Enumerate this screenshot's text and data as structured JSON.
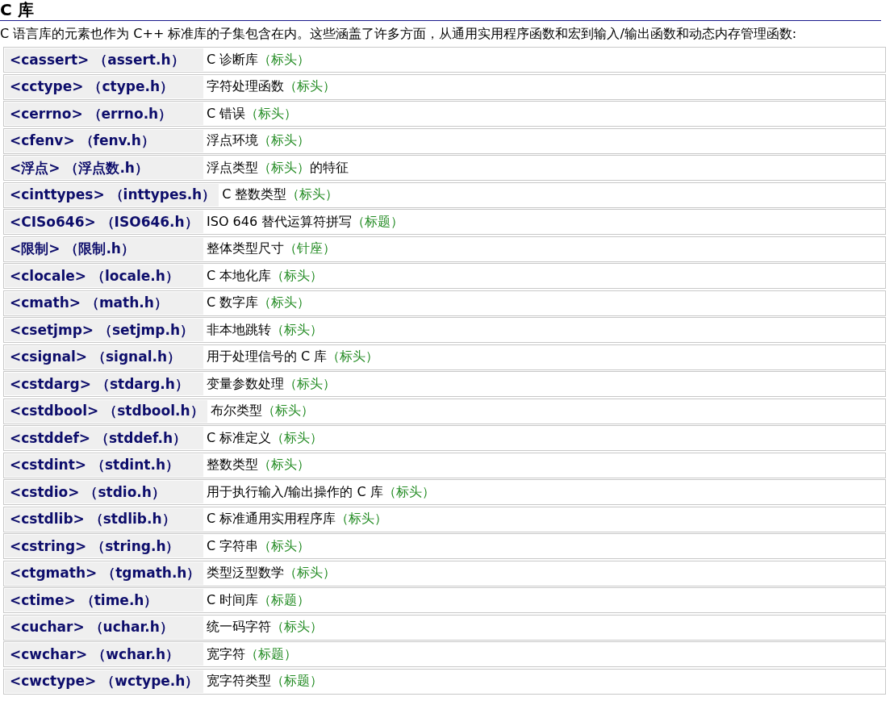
{
  "title": "C 库",
  "intro": "C 语言库的元素也作为 C++ 标准库的子集包含在内。这些涵盖了许多方面，从通用实用程序函数和宏到输入/输出函数和动态内存管理函数:",
  "libraries": [
    {
      "header": "<cassert> （assert.h）",
      "text": "C 诊断库",
      "note": "（标头）"
    },
    {
      "header": "<cctype> （ctype.h）",
      "text": "字符处理函数",
      "note": "（标头）"
    },
    {
      "header": "<cerrno> （errno.h）",
      "text": "C 错误",
      "note": "（标头）"
    },
    {
      "header": "<cfenv> （fenv.h）",
      "text": "浮点环境",
      "note": "（标头）"
    },
    {
      "header": "<浮点> （浮点数.h）",
      "text": "浮点类型",
      "note": "（标头）",
      "suffix": "的特征"
    },
    {
      "header": "<cinttypes> （inttypes.h）",
      "text": "C 整数类型",
      "note": "（标头）"
    },
    {
      "header": "<CISo646> （ISO646.h）",
      "text": "ISO 646 替代运算符拼写",
      "note": "（标题）"
    },
    {
      "header": "<限制> （限制.h）",
      "text": "整体类型尺寸",
      "note": "（针座）"
    },
    {
      "header": "<clocale> （locale.h）",
      "text": "C 本地化库",
      "note": "（标头）"
    },
    {
      "header": "<cmath> （math.h）",
      "text": "C 数字库",
      "note": "（标头）"
    },
    {
      "header": "<csetjmp> （setjmp.h）",
      "text": "非本地跳转",
      "note": "（标头）"
    },
    {
      "header": "<csignal> （signal.h）",
      "text": "用于处理信号的 C 库",
      "note": "（标头）"
    },
    {
      "header": "<cstdarg> （stdarg.h）",
      "text": "变量参数处理",
      "note": "（标头）"
    },
    {
      "header": "<cstdbool> （stdbool.h）",
      "text": "布尔类型",
      "note": "（标头）"
    },
    {
      "header": "<cstddef> （stddef.h）",
      "text": "C 标准定义",
      "note": "（标头）"
    },
    {
      "header": "<cstdint> （stdint.h）",
      "text": "整数类型",
      "note": "（标头）"
    },
    {
      "header": "<cstdio> （stdio.h）",
      "text": "用于执行输入/输出操作的 C 库",
      "note": "（标头）"
    },
    {
      "header": "<cstdlib> （stdlib.h）",
      "text": "C 标准通用实用程序库",
      "note": "（标头）"
    },
    {
      "header": "<cstring> （string.h）",
      "text": "C 字符串",
      "note": "（标头）"
    },
    {
      "header": "<ctgmath> （tgmath.h）",
      "text": "类型泛型数学",
      "note": "（标头）"
    },
    {
      "header": "<ctime> （time.h）",
      "text": "C 时间库",
      "note": "（标题）"
    },
    {
      "header": "<cuchar> （uchar.h）",
      "text": "统一码字符",
      "note": "（标头）"
    },
    {
      "header": "<cwchar> （wchar.h）",
      "text": "宽字符",
      "note": "（标题）"
    },
    {
      "header": "<cwctype> （wctype.h）",
      "text": "宽字符类型",
      "note": "（标题）"
    }
  ]
}
